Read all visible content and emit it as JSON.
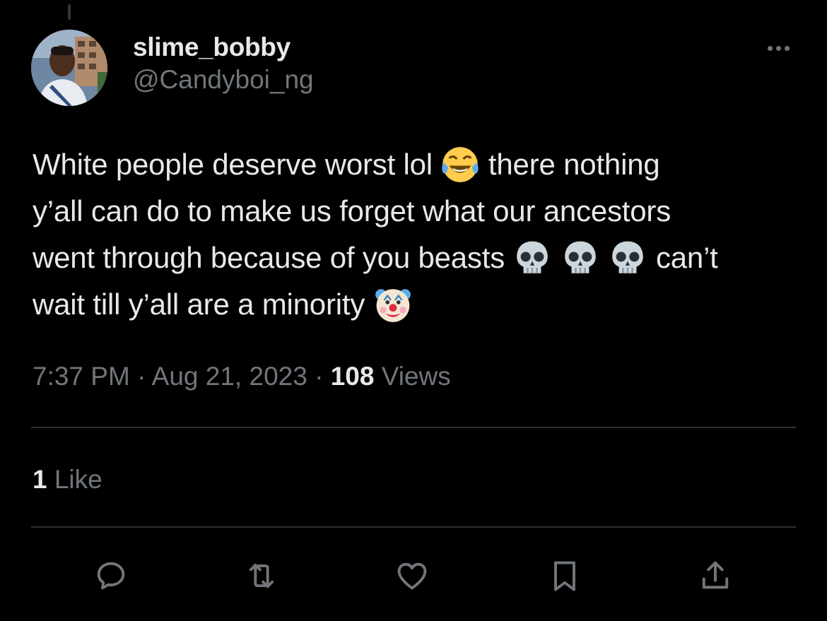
{
  "author": {
    "display_name": "slime_bobby",
    "handle": "@Candyboi_ng"
  },
  "tweet": {
    "line1_a": "White people deserve worst lol",
    "line1_emoji": "face-with-tears-of-joy-emoji",
    "line1_b": "there nothing",
    "line2": "y’all can do to make us forget what our ancestors",
    "line3_a": "went through because of you beasts",
    "line3_emojis": [
      "skull-emoji",
      "skull-emoji",
      "skull-emoji"
    ],
    "line3_b": "can’t",
    "line4_a": "wait till y’all are a minority",
    "line4_emoji": "clown-face-emoji"
  },
  "meta": {
    "time": "7:37 PM",
    "separator": "·",
    "date": "Aug 21, 2023",
    "views_count": "108",
    "views_label": "Views"
  },
  "engagement": {
    "likes_count": "1",
    "likes_label": "Like"
  },
  "actions": [
    {
      "icon": "reply-icon"
    },
    {
      "icon": "retweet-icon"
    },
    {
      "icon": "like-heart-icon"
    },
    {
      "icon": "bookmark-icon"
    },
    {
      "icon": "share-icon"
    }
  ],
  "colors": {
    "background": "#000000",
    "primary_text": "#e7e9ea",
    "secondary_text": "#71767b",
    "divider": "#2f3336"
  }
}
